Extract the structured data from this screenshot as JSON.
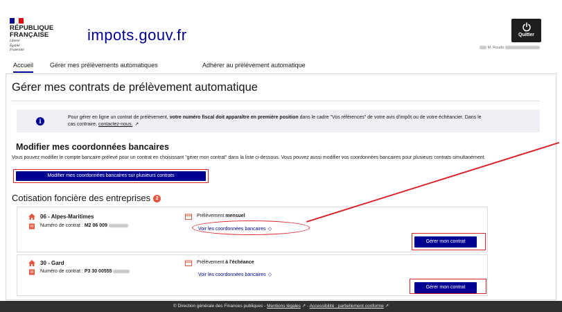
{
  "header": {
    "republic_line1": "RÉPUBLIQUE",
    "republic_line2": "FRANÇAISE",
    "motto": [
      "Liberté",
      "Égalité",
      "Fraternité"
    ],
    "site_name": "impots.gouv.fr",
    "quit_label": "Quitter",
    "user_prefix": "M. Roudo"
  },
  "nav": {
    "tabs": [
      {
        "label": "Accueil",
        "active": true
      },
      {
        "label": "Gérer mes prélèvements automatiques",
        "active": false
      },
      {
        "label": "Adhérer au prélèvement automatique",
        "active": false
      }
    ]
  },
  "main": {
    "title": "Gérer mes contrats de prélèvement automatique",
    "info": {
      "text_before": "Pour gérer en ligne un contrat de prélèvement, ",
      "text_bold": "votre numéro fiscal doit apparaître en première position",
      "text_after": " dans le cadre \"Vos références\" de votre avis d'impôt ou de votre échéancier. Dans le cas contraire, ",
      "link": "contactez-nous."
    },
    "bank_section": {
      "title": "Modifier mes coordonnées bancaires",
      "description": "Vous pouvez modifier le compte bancaire prélevé pour un contrat en choisissant \"gérer mon contrat\" dans la liste ci-dessous. Vous pouvez aussi modifier vos coordonnées bancaires pour plusieurs contrats simultanément.",
      "button": "Modifier mes coordonnées bancaires sur plusieurs contrats"
    },
    "cfe_section": {
      "title": "Cotisation foncière des entreprises",
      "badge": "2",
      "contracts": [
        {
          "department": "06 - Alpes-Maritimes",
          "contract_label": "Numéro de contrat : ",
          "contract_number": "M2 06 009",
          "payment_prefix": "Prélèvement ",
          "payment_mode": "mensuel",
          "link": "Voir les coordonnées bancaires",
          "button": "Gérer mon contrat"
        },
        {
          "department": "30 - Gard",
          "contract_label": "Numéro de contrat : ",
          "contract_number": "P3 30 00555",
          "payment_prefix": "Prélèvement ",
          "payment_mode": "à l'échéance",
          "link": "Voir les coordonnées bancaires",
          "button": "Gérer mon contrat"
        }
      ]
    }
  },
  "footer": {
    "copyright": "© Direction générale des Finances publiques - ",
    "legal": "Mentions légales",
    "accessibility": "Accessibilité : partiellement conforme"
  },
  "colors": {
    "primary": "#000091",
    "annotation_red": "#d8232a",
    "badge": "#e2553f",
    "footer_bg": "#303030",
    "info_bg": "#eeeef4"
  },
  "icons": {
    "info": "info-icon",
    "external": "external-link-icon",
    "home": "home-icon",
    "document": "document-icon",
    "calendar": "calendar-icon",
    "chevron": "chevron-icon",
    "power": "power-icon"
  }
}
